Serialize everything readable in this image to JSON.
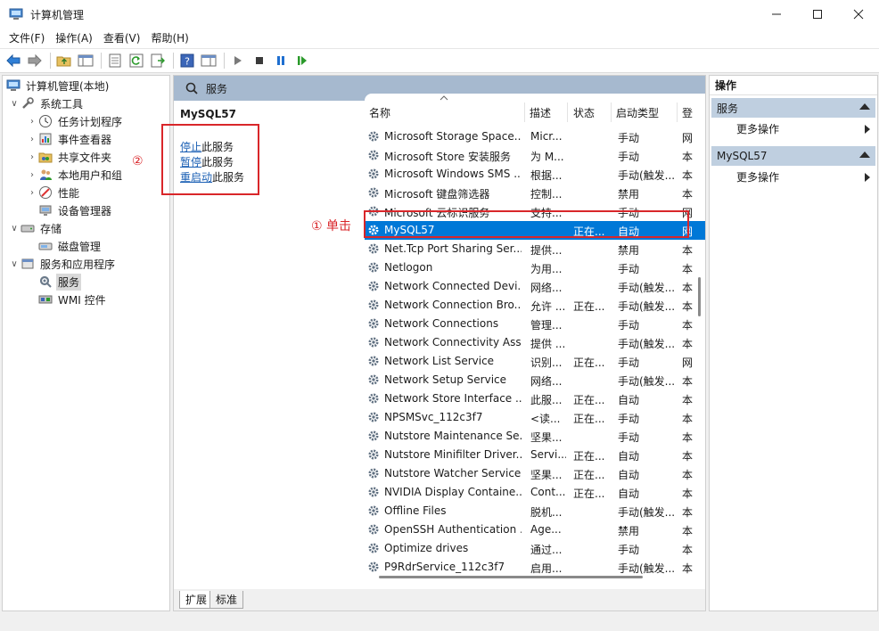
{
  "window": {
    "title": "计算机管理"
  },
  "menubar": [
    "文件(F)",
    "操作(A)",
    "查看(V)",
    "帮助(H)"
  ],
  "tree": [
    {
      "label": "计算机管理(本地)",
      "level": 0,
      "expander": "",
      "icon": "computer-management-icon"
    },
    {
      "label": "系统工具",
      "level": 1,
      "expander": "∨",
      "icon": "system-tools-icon"
    },
    {
      "label": "任务计划程序",
      "level": 2,
      "expander": "›",
      "icon": "task-scheduler-icon"
    },
    {
      "label": "事件查看器",
      "level": 2,
      "expander": "›",
      "icon": "event-viewer-icon"
    },
    {
      "label": "共享文件夹",
      "level": 2,
      "expander": "›",
      "icon": "shared-folder-icon"
    },
    {
      "label": "本地用户和组",
      "level": 2,
      "expander": "›",
      "icon": "local-users-icon"
    },
    {
      "label": "性能",
      "level": 2,
      "expander": "›",
      "icon": "performance-icon"
    },
    {
      "label": "设备管理器",
      "level": 2,
      "expander": "",
      "icon": "device-manager-icon"
    },
    {
      "label": "存储",
      "level": 1,
      "expander": "∨",
      "icon": "storage-icon"
    },
    {
      "label": "磁盘管理",
      "level": 2,
      "expander": "",
      "icon": "disk-management-icon"
    },
    {
      "label": "服务和应用程序",
      "level": 1,
      "expander": "∨",
      "icon": "services-apps-icon"
    },
    {
      "label": "服务",
      "level": 2,
      "expander": "",
      "icon": "services-icon",
      "selected": true
    },
    {
      "label": "WMI 控件",
      "level": 2,
      "expander": "",
      "icon": "wmi-control-icon"
    }
  ],
  "middle": {
    "header": "服务",
    "selected_service": "MySQL57",
    "actions": [
      {
        "link": "停止",
        "rest": "此服务"
      },
      {
        "link": "暂停",
        "rest": "此服务"
      },
      {
        "link": "重启动",
        "rest": "此服务"
      }
    ],
    "columns": [
      "名称",
      "描述",
      "状态",
      "启动类型",
      "登"
    ],
    "services": [
      {
        "name": "Microsoft Storage Space...",
        "desc": "Micr...",
        "status": "",
        "startup": "手动",
        "logon": "网"
      },
      {
        "name": "Microsoft Store 安装服务",
        "desc": "为 M...",
        "status": "",
        "startup": "手动",
        "logon": "本"
      },
      {
        "name": "Microsoft Windows SMS ...",
        "desc": "根据...",
        "status": "",
        "startup": "手动(触发...",
        "logon": "本"
      },
      {
        "name": "Microsoft 键盘筛选器",
        "desc": "控制...",
        "status": "",
        "startup": "禁用",
        "logon": "本"
      },
      {
        "name": "Microsoft 云标识服务",
        "desc": "支持...",
        "status": "",
        "startup": "手动",
        "logon": "网"
      },
      {
        "name": "MySQL57",
        "desc": "",
        "status": "正在...",
        "startup": "自动",
        "logon": "网",
        "selected": true
      },
      {
        "name": "Net.Tcp Port Sharing Ser...",
        "desc": "提供...",
        "status": "",
        "startup": "禁用",
        "logon": "本"
      },
      {
        "name": "Netlogon",
        "desc": "为用...",
        "status": "",
        "startup": "手动",
        "logon": "本"
      },
      {
        "name": "Network Connected Devi...",
        "desc": "网络...",
        "status": "",
        "startup": "手动(触发...",
        "logon": "本"
      },
      {
        "name": "Network Connection Bro...",
        "desc": "允许 ...",
        "status": "正在...",
        "startup": "手动(触发...",
        "logon": "本"
      },
      {
        "name": "Network Connections",
        "desc": "管理...",
        "status": "",
        "startup": "手动",
        "logon": "本"
      },
      {
        "name": "Network Connectivity Ass...",
        "desc": "提供 ...",
        "status": "",
        "startup": "手动(触发...",
        "logon": "本"
      },
      {
        "name": "Network List Service",
        "desc": "识别...",
        "status": "正在...",
        "startup": "手动",
        "logon": "网"
      },
      {
        "name": "Network Setup Service",
        "desc": "网络...",
        "status": "",
        "startup": "手动(触发...",
        "logon": "本"
      },
      {
        "name": "Network Store Interface ...",
        "desc": "此服...",
        "status": "正在...",
        "startup": "自动",
        "logon": "本"
      },
      {
        "name": "NPSMSvc_112c3f7",
        "desc": "<读...",
        "status": "正在...",
        "startup": "手动",
        "logon": "本"
      },
      {
        "name": "Nutstore Maintenance Se...",
        "desc": "坚果...",
        "status": "",
        "startup": "手动",
        "logon": "本"
      },
      {
        "name": "Nutstore Minifilter Driver...",
        "desc": "Servi...",
        "status": "正在...",
        "startup": "自动",
        "logon": "本"
      },
      {
        "name": "Nutstore Watcher Service",
        "desc": "坚果...",
        "status": "正在...",
        "startup": "自动",
        "logon": "本"
      },
      {
        "name": "NVIDIA Display Containe...",
        "desc": "Cont...",
        "status": "正在...",
        "startup": "自动",
        "logon": "本"
      },
      {
        "name": "Offline Files",
        "desc": "脱机...",
        "status": "",
        "startup": "手动(触发...",
        "logon": "本"
      },
      {
        "name": "OpenSSH Authentication ...",
        "desc": "Age...",
        "status": "",
        "startup": "禁用",
        "logon": "本"
      },
      {
        "name": "Optimize drives",
        "desc": "通过...",
        "status": "",
        "startup": "手动",
        "logon": "本"
      },
      {
        "name": "P9RdrService_112c3f7",
        "desc": "启用...",
        "status": "",
        "startup": "手动(触发...",
        "logon": "本"
      }
    ],
    "tabs": [
      "扩展",
      "标准"
    ]
  },
  "actions_pane": {
    "title": "操作",
    "groups": [
      {
        "label": "服务",
        "items": [
          "更多操作"
        ]
      },
      {
        "label": "MySQL57",
        "items": [
          "更多操作"
        ]
      }
    ]
  },
  "annotations": {
    "click_label": "① 单击",
    "step2_label": "②"
  },
  "colors": {
    "selection": "#0078d7",
    "header_band": "#a6b9cf",
    "action_group": "#bfcfe0",
    "annotation": "#d9262a",
    "link": "#1a5fb4"
  }
}
